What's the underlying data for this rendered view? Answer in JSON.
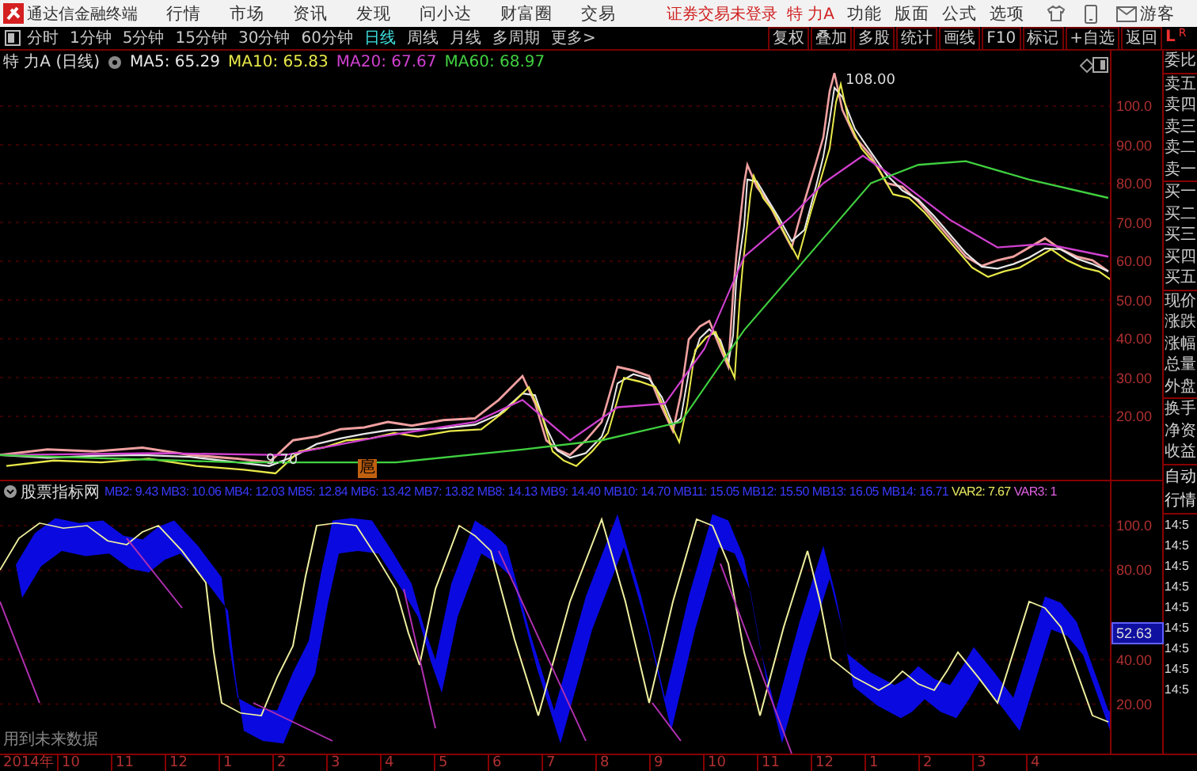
{
  "app": {
    "title": "通达信金融终端",
    "menus": [
      "行情",
      "市场",
      "资讯",
      "发现",
      "问小达",
      "财富圈",
      "交易"
    ],
    "login_status": "证券交易未登录",
    "stock": "特 力A",
    "tools": [
      "功能",
      "版面",
      "公式",
      "选项"
    ],
    "user": "游客"
  },
  "periods": [
    {
      "label": "分时",
      "selected": false
    },
    {
      "label": "1分钟",
      "selected": false
    },
    {
      "label": "5分钟",
      "selected": false
    },
    {
      "label": "15分钟",
      "selected": false
    },
    {
      "label": "30分钟",
      "selected": false
    },
    {
      "label": "60分钟",
      "selected": false
    },
    {
      "label": "日线",
      "selected": true
    },
    {
      "label": "周线",
      "selected": false
    },
    {
      "label": "月线",
      "selected": false
    },
    {
      "label": "多周期",
      "selected": false
    },
    {
      "label": "更多>",
      "selected": false
    }
  ],
  "actions": [
    "复权",
    "叠加",
    "多股",
    "统计",
    "画线",
    "F10",
    "标记",
    "+自选",
    "返回"
  ],
  "corner": [
    "L",
    "R"
  ],
  "chart": {
    "title": "特 力A (日线)",
    "ma": [
      {
        "label": "MA5: 65.29",
        "color": "#e8e8e8"
      },
      {
        "label": "MA10: 65.83",
        "color": "#e8e84a"
      },
      {
        "label": "MA20: 67.67",
        "color": "#d040d0"
      },
      {
        "label": "MA60: 68.97",
        "color": "#40d040"
      }
    ],
    "high_label": "108.00",
    "low_label": "9.70",
    "marker": "扈",
    "ticks": [
      "100.0",
      "90.00",
      "80.00",
      "70.00",
      "60.00",
      "50.00",
      "40.00",
      "30.00",
      "20.00"
    ]
  },
  "indicator": {
    "title": "股票指标网",
    "lines": [
      {
        "label": "MB2: 9.43",
        "color": "#3a3aff"
      },
      {
        "label": "MB3: 10.06",
        "color": "#3a3aff"
      },
      {
        "label": "MB4: 12.03",
        "color": "#3a3aff"
      },
      {
        "label": "MB5: 12.84",
        "color": "#3a3aff"
      },
      {
        "label": "MB6: 13.42",
        "color": "#3a3aff"
      },
      {
        "label": "MB7: 13.82",
        "color": "#3a3aff"
      },
      {
        "label": "MB8: 14.13",
        "color": "#3a3aff"
      },
      {
        "label": "MB9: 14.40",
        "color": "#3a3aff"
      },
      {
        "label": "MB10: 14.70",
        "color": "#3a3aff"
      },
      {
        "label": "MB11: 15.05",
        "color": "#3a3aff"
      },
      {
        "label": "MB12: 15.50",
        "color": "#3a3aff"
      },
      {
        "label": "MB13: 16.05",
        "color": "#3a3aff"
      },
      {
        "label": "MB14: 16.71",
        "color": "#3a3aff"
      },
      {
        "label": "VAR2: 7.67",
        "color": "#e8e860"
      },
      {
        "label": "VAR3: 1",
        "color": "#e060e0"
      }
    ],
    "ticks": [
      "100.0",
      "80.00",
      "40.00",
      "20.00"
    ],
    "current": "52.63",
    "note": "用到未来数据"
  },
  "x_axis": [
    "2014年",
    "10",
    "11",
    "12",
    "1",
    "2",
    "3",
    "4",
    "5",
    "6",
    "7",
    "8",
    "9",
    "10",
    "11",
    "12",
    "1",
    "2",
    "3",
    "4"
  ],
  "quote_panel": {
    "groups": [
      [
        "委比"
      ],
      [
        "卖五",
        "卖四",
        "卖三",
        "卖二",
        "卖一"
      ],
      [
        "买一",
        "买二",
        "买三",
        "买四",
        "买五"
      ],
      [
        "现价",
        "涨跌",
        "涨幅",
        "总量",
        "外盘"
      ],
      [
        "换手",
        "净资",
        "收益"
      ]
    ],
    "mode": [
      "自动",
      "行情"
    ],
    "times": [
      "14:5",
      "14:5",
      "14:5",
      "14:5",
      "14:5",
      "14:5",
      "14:5",
      "14:5",
      "14:5"
    ]
  }
}
